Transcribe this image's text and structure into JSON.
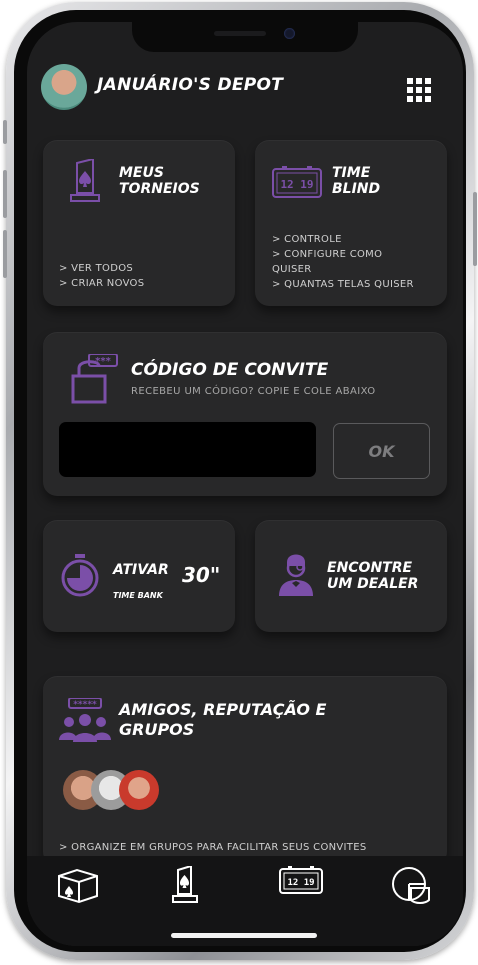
{
  "header": {
    "title": "JANUÁRIO'S DEPOT"
  },
  "cards": {
    "tournaments": {
      "title_line1": "MEUS",
      "title_line2": "TORNEIOS",
      "links": [
        "> VER TODOS",
        "> CRIAR NOVOS"
      ]
    },
    "time_blind": {
      "title_line1": "TIME",
      "title_line2": "BLIND",
      "clock_text": "12 19",
      "links": [
        "> CONTROLE",
        "> CONFIGURE COMO",
        "QUISER",
        "> QUANTAS TELAS QUISER"
      ]
    },
    "invite": {
      "title": "CÓDIGO DE CONVITE",
      "subtitle": "RECEBEU UM CÓDIGO? COPIE E COLE ABAIXO",
      "input_value": "",
      "input_placeholder": "",
      "ok_label": "OK"
    },
    "time_bank": {
      "title": "ATIVAR",
      "subtitle": "TIME BANK",
      "seconds": "30\""
    },
    "dealer": {
      "title_line1": "ENCONTRE",
      "title_line2": "UM DEALER"
    },
    "friends": {
      "title_line1": "AMIGOS, REPUTAÇÃO E",
      "title_line2": "GRUPOS",
      "link": "> ORGANIZE EM GRUPOS PARA FACILITAR SEUS CONVITES"
    }
  },
  "tabbar": {
    "clock_text": "12 19"
  },
  "colors": {
    "accent": "#7b4fa8",
    "card_bg": "#282829",
    "screen_bg": "#1e1e1f"
  },
  "icons": [
    "grid-icon",
    "trophy-spade-icon",
    "digital-clock-icon",
    "padlock-icon",
    "stopwatch-icon",
    "dealer-icon",
    "group-icon",
    "card-box-icon",
    "chips-icon"
  ]
}
